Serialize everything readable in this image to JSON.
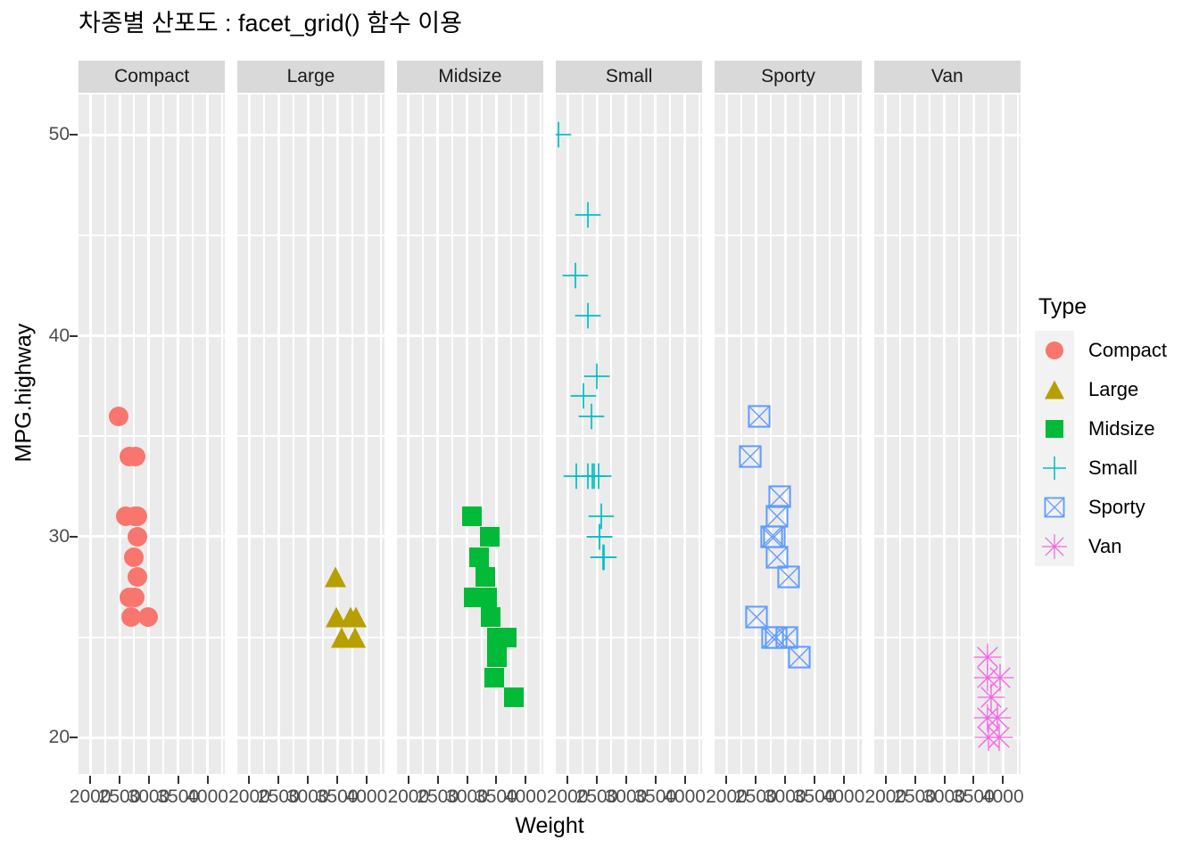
{
  "title": "차종별 산포도 : facet_grid() 함수 이용",
  "axes": {
    "x_title": "Weight",
    "y_title": "MPG.highway",
    "x_ticks": [
      2000,
      2500,
      3000,
      3500,
      4000
    ],
    "y_ticks": [
      20,
      30,
      40,
      50
    ],
    "x_tick_labels": [
      "2000",
      "2500",
      "3000",
      "3500",
      "4000"
    ],
    "y_tick_labels": [
      "20",
      "30",
      "40",
      "50"
    ]
  },
  "legend": {
    "title": "Type",
    "items": [
      {
        "label": "Compact",
        "color": "#F8766D",
        "shape": "circle"
      },
      {
        "label": "Large",
        "color": "#B79F00",
        "shape": "triangle"
      },
      {
        "label": "Midsize",
        "color": "#00BA38",
        "shape": "square"
      },
      {
        "label": "Small",
        "color": "#00BFC4",
        "shape": "cross"
      },
      {
        "label": "Sporty",
        "color": "#619CFF",
        "shape": "boxcross"
      },
      {
        "label": "Van",
        "color": "#F564E3",
        "shape": "asterisk"
      }
    ]
  },
  "facets": [
    "Compact",
    "Large",
    "Midsize",
    "Small",
    "Sporty",
    "Van"
  ],
  "chart_data": {
    "type": "scatter",
    "title": "차종별 산포도 : facet_grid() 함수 이용",
    "xlabel": "Weight",
    "ylabel": "MPG.highway",
    "xlim": [
      1800,
      4300
    ],
    "ylim": [
      18.2,
      52.0
    ],
    "grid": true,
    "legend_position": "right",
    "facet_by": "Type",
    "facets": [
      "Compact",
      "Large",
      "Midsize",
      "Small",
      "Sporty",
      "Van"
    ],
    "series": [
      {
        "name": "Compact",
        "color": "#F8766D",
        "shape": "circle",
        "points": [
          [
            2490,
            36
          ],
          [
            2670,
            34
          ],
          [
            2775,
            34
          ],
          [
            2600,
            31
          ],
          [
            2755,
            31
          ],
          [
            2810,
            31
          ],
          [
            2810,
            30
          ],
          [
            2740,
            29
          ],
          [
            2810,
            28
          ],
          [
            2670,
            27
          ],
          [
            2760,
            27
          ],
          [
            2700,
            26
          ],
          [
            2990,
            26
          ]
        ]
      },
      {
        "name": "Large",
        "color": "#B79F00",
        "shape": "triangle",
        "points": [
          [
            3470,
            28
          ],
          [
            3490,
            26
          ],
          [
            3725,
            26
          ],
          [
            3815,
            26
          ],
          [
            3570,
            25
          ],
          [
            3805,
            25
          ]
        ]
      },
      {
        "name": "Midsize",
        "color": "#00BA38",
        "shape": "square",
        "points": [
          [
            3085,
            31
          ],
          [
            3385,
            30
          ],
          [
            3200,
            29
          ],
          [
            3310,
            28
          ],
          [
            3110,
            27
          ],
          [
            3340,
            27
          ],
          [
            3405,
            26
          ],
          [
            3510,
            25
          ],
          [
            3680,
            25
          ],
          [
            3510,
            24
          ],
          [
            3460,
            23
          ],
          [
            3805,
            22
          ]
        ]
      },
      {
        "name": "Small",
        "color": "#00BFC4",
        "shape": "cross",
        "points": [
          [
            1845,
            50
          ],
          [
            2350,
            46
          ],
          [
            2140,
            43
          ],
          [
            2350,
            41
          ],
          [
            2500,
            38
          ],
          [
            2270,
            37
          ],
          [
            2410,
            36
          ],
          [
            2150,
            33
          ],
          [
            2350,
            33
          ],
          [
            2430,
            33
          ],
          [
            2455,
            33
          ],
          [
            2530,
            33
          ],
          [
            2575,
            31
          ],
          [
            2540,
            30
          ],
          [
            2550,
            30
          ],
          [
            2610,
            29
          ],
          [
            2620,
            29
          ]
        ]
      },
      {
        "name": "Sporty",
        "color": "#619CFF",
        "shape": "boxcross",
        "points": [
          [
            2560,
            36
          ],
          [
            2400,
            34
          ],
          [
            2900,
            32
          ],
          [
            2860,
            31
          ],
          [
            2775,
            30
          ],
          [
            2810,
            30
          ],
          [
            2860,
            29
          ],
          [
            3060,
            28
          ],
          [
            2510,
            26
          ],
          [
            2790,
            25
          ],
          [
            2840,
            25
          ],
          [
            3020,
            25
          ],
          [
            3245,
            24
          ]
        ]
      },
      {
        "name": "Van",
        "color": "#F564E3",
        "shape": "asterisk",
        "points": [
          [
            3735,
            24
          ],
          [
            3740,
            23
          ],
          [
            3950,
            23
          ],
          [
            3800,
            22
          ],
          [
            3730,
            21
          ],
          [
            3910,
            21
          ],
          [
            3750,
            20
          ],
          [
            3935,
            20
          ]
        ]
      }
    ]
  }
}
